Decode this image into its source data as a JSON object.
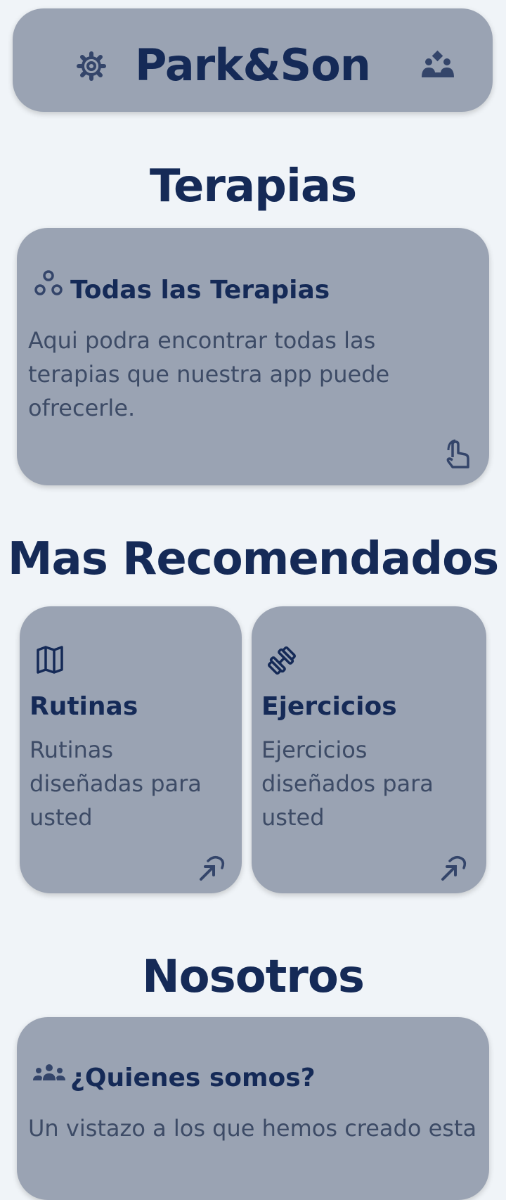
{
  "header": {
    "title": "Park&Son",
    "settings_icon": "gear-icon",
    "team_icon": "team-icon"
  },
  "terapias": {
    "section_title": "Terapias",
    "card": {
      "icon": "circles-icon",
      "title": "Todas las Terapias",
      "description": "Aqui podra encontrar todas las terapias que nuestra app puede ofrecerle.",
      "action_icon": "tap-icon"
    }
  },
  "recomendados": {
    "section_title": "Mas Recomendados",
    "cards": [
      {
        "icon": "map-icon",
        "title": "Rutinas",
        "description": "Rutinas diseñadas para usted",
        "action_icon": "pointer-icon"
      },
      {
        "icon": "dumbbell-icon",
        "title": "Ejercicios",
        "description": "Ejercicios diseñados para usted",
        "action_icon": "pointer-icon"
      }
    ]
  },
  "nosotros": {
    "section_title": "Nosotros",
    "card": {
      "icon": "people-icon",
      "title": "¿Quienes somos?",
      "description": "Un vistazo a los que hemos creado esta"
    }
  },
  "colors": {
    "background": "#f0f4f8",
    "card": "#9aa3b3",
    "primary": "#152a57",
    "body_text": "#3d4b66"
  }
}
